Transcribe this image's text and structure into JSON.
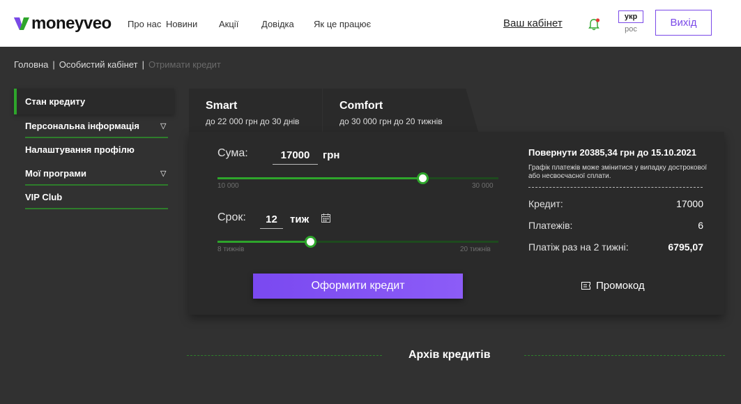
{
  "header": {
    "logo_text": "moneyveo",
    "nav": [
      "Про нас",
      "Новини",
      "Акції",
      "Довідка",
      "Як це працює"
    ],
    "cabinet_link": "Ваш кабінет",
    "lang_active": "укр",
    "lang_alt": "рос",
    "logout_label": "Вихід"
  },
  "breadcrumb": {
    "home": "Головна",
    "cabinet": "Особистий кабінет",
    "current": "Отримати кредит",
    "separator": "|"
  },
  "sidebar": {
    "items": [
      {
        "label": "Стан кредиту"
      },
      {
        "label": "Персональна інформація",
        "arrow": "▽"
      },
      {
        "label": "Налаштування профілю"
      },
      {
        "label": "Мої програми",
        "arrow": "▽"
      },
      {
        "label": "VIP Club"
      }
    ]
  },
  "tabs": [
    {
      "title": "Smart",
      "subtitle": "до 22 000 грн до 30 днів"
    },
    {
      "title": "Comfort",
      "subtitle": "до 30 000 грн до 20 тижнів"
    }
  ],
  "calculator": {
    "amount_label": "Сума:",
    "amount_value": "17000",
    "amount_unit": "грн",
    "amount_min_label": "10 000",
    "amount_max_label": "30 000",
    "amount_fraction": 0.73,
    "term_label": "Срок:",
    "term_value": "12",
    "term_unit": "тиж",
    "term_min_label": "8 тижнів",
    "term_max_label": "20 тижнів",
    "term_fraction": 0.33,
    "cta_label": "Оформити кредит"
  },
  "summary": {
    "title": "Повернути 20385,34 грн до 15.10.2021",
    "note": "Графік платежів може змінитися у випадку дострокової або несвоєчасної сплати.",
    "rows": [
      {
        "label": "Кредит:",
        "value": "17000"
      },
      {
        "label": "Платежів:",
        "value": "6"
      },
      {
        "label": "Платіж раз на 2 тижні:",
        "value": "6795,07"
      }
    ],
    "promo_label": "Промокод"
  },
  "archive": {
    "title": "Архів кредитів"
  },
  "colors": {
    "accent_purple": "#7a49e8",
    "accent_green": "#2ea52b",
    "background": "#313131",
    "panel": "#2a2a2a"
  }
}
